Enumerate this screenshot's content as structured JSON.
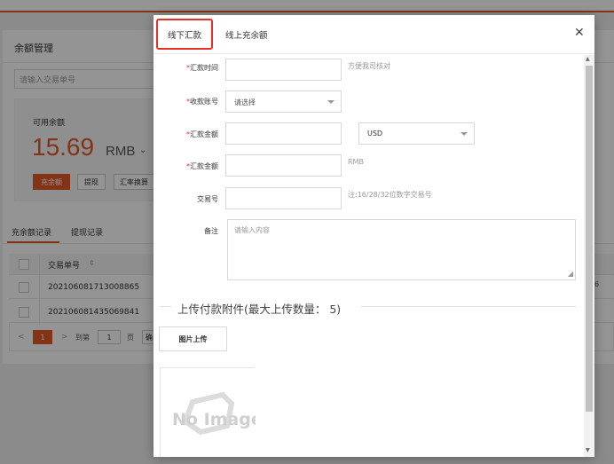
{
  "background": {
    "title": "余额管理",
    "search_placeholder": "请输入交易单号",
    "balance_label": "可用余额",
    "balance_value": "15.69",
    "balance_unit": "RMB",
    "buttons": {
      "recharge": "充余额",
      "withdraw": "提现",
      "rate": "汇率换算"
    },
    "tabs": [
      "充余额记录",
      "提现记录"
    ],
    "table": {
      "col_order_no": "交易单号",
      "rows": [
        "202106081713008865",
        "202106081435069841"
      ]
    },
    "pager": {
      "current": "1",
      "goto": "到第",
      "page_input": "1",
      "page": "页",
      "confirm": "确定"
    },
    "right_stub": "6"
  },
  "modal": {
    "tabs": {
      "offline": "线下汇款",
      "online": "线上充余额"
    },
    "form": {
      "remit_time_label": "汇款时间",
      "remit_time_hint": "方便我司核对",
      "account_label": "收款账号",
      "account_placeholder": "请选择",
      "amount_label": "汇款金额",
      "currency_value": "USD",
      "amount2_label": "汇款金额",
      "amount2_hint": "RMB",
      "txn_label": "交易号",
      "txn_hint": "注:16/28/32位数字交易号",
      "remark_label": "备注",
      "remark_placeholder": "请输入内容"
    },
    "upload": {
      "section_title": "上传付款附件(最大上传数量： 5)",
      "button": "图片上传",
      "no_image_text": "No Image"
    }
  },
  "colors": {
    "accent": "#e35b26",
    "required": "#e8302a",
    "highlight_border": "#e8302a"
  }
}
